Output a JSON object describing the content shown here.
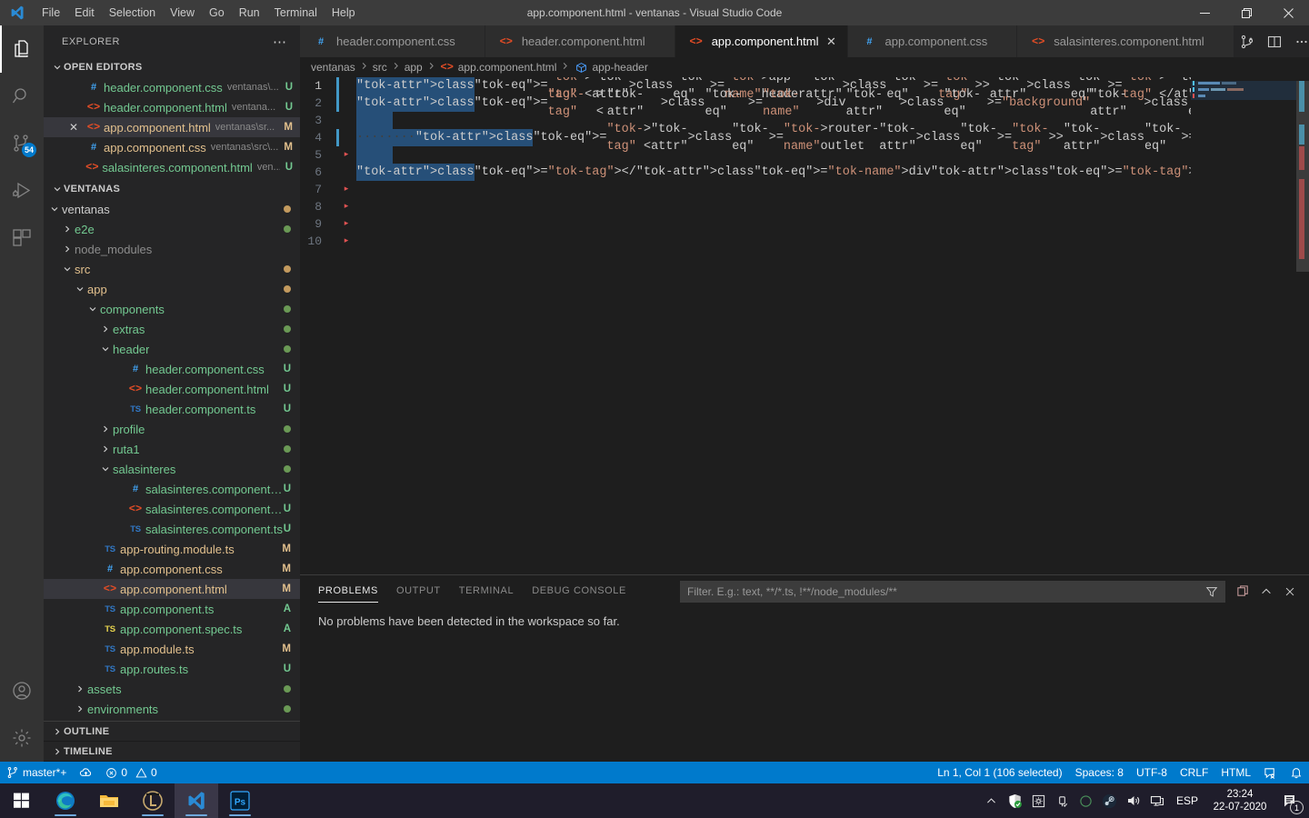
{
  "window": {
    "title": "app.component.html - ventanas - Visual Studio Code",
    "menus": [
      "File",
      "Edit",
      "Selection",
      "View",
      "Go",
      "Run",
      "Terminal",
      "Help"
    ],
    "controls": {
      "minimize": "─",
      "restore": "❐",
      "close": "✕"
    }
  },
  "activitybar": {
    "items": [
      {
        "name": "explorer",
        "icon": "files-icon",
        "badge": ""
      },
      {
        "name": "search",
        "icon": "search-icon",
        "badge": ""
      },
      {
        "name": "source-control",
        "icon": "source-control-icon",
        "badge": "54"
      },
      {
        "name": "run-and-debug",
        "icon": "debug-icon",
        "badge": ""
      },
      {
        "name": "extensions",
        "icon": "extensions-icon",
        "badge": ""
      }
    ],
    "bottom": [
      {
        "name": "accounts",
        "icon": "account-icon"
      },
      {
        "name": "manage",
        "icon": "gear-icon"
      }
    ]
  },
  "sidebar": {
    "title": "EXPLORER",
    "more_actions": "⋯",
    "open_editors": {
      "header": "OPEN EDITORS",
      "items": [
        {
          "name": "header.component.css",
          "path": "ventanas\\...",
          "status": "U",
          "icon": "css",
          "selected": false,
          "dirty": false
        },
        {
          "name": "header.component.html",
          "path": "ventana...",
          "status": "U",
          "icon": "html",
          "selected": false,
          "dirty": false
        },
        {
          "name": "app.component.html",
          "path": "ventanas\\sr...",
          "status": "M",
          "icon": "html",
          "selected": true,
          "dirty": false
        },
        {
          "name": "app.component.css",
          "path": "ventanas\\src\\...",
          "status": "M",
          "icon": "css",
          "selected": false,
          "dirty": false
        },
        {
          "name": "salasinteres.component.html",
          "path": "ven...",
          "status": "U",
          "icon": "html",
          "selected": false,
          "dirty": false
        }
      ]
    },
    "workspace": {
      "header": "VENTANAS",
      "rows": [
        {
          "label": "ventanas",
          "depth": 1,
          "type": "folder",
          "expanded": true,
          "dot": "#c39a5e"
        },
        {
          "label": "e2e",
          "depth": 2,
          "type": "folder",
          "expanded": false,
          "dot": "#6a9955",
          "color": "#73c991"
        },
        {
          "label": "node_modules",
          "depth": 2,
          "type": "folder",
          "expanded": false,
          "color": "#8c8c8c"
        },
        {
          "label": "src",
          "depth": 2,
          "type": "folder",
          "expanded": true,
          "dot": "#c39a5e",
          "color": "#e2c08d"
        },
        {
          "label": "app",
          "depth": 3,
          "type": "folder",
          "expanded": true,
          "dot": "#c39a5e",
          "color": "#e2c08d"
        },
        {
          "label": "components",
          "depth": 4,
          "type": "folder",
          "expanded": true,
          "dot": "#6a9955",
          "color": "#73c991"
        },
        {
          "label": "extras",
          "depth": 5,
          "type": "folder",
          "expanded": false,
          "dot": "#6a9955",
          "color": "#73c991"
        },
        {
          "label": "header",
          "depth": 5,
          "type": "folder",
          "expanded": true,
          "dot": "#6a9955",
          "color": "#73c991"
        },
        {
          "label": "header.component.css",
          "depth": 6,
          "type": "file",
          "icon": "css",
          "status": "U",
          "color": "#73c991"
        },
        {
          "label": "header.component.html",
          "depth": 6,
          "type": "file",
          "icon": "html",
          "status": "U",
          "color": "#73c991"
        },
        {
          "label": "header.component.ts",
          "depth": 6,
          "type": "file",
          "icon": "ts",
          "status": "U",
          "color": "#73c991"
        },
        {
          "label": "profile",
          "depth": 5,
          "type": "folder",
          "expanded": false,
          "dot": "#6a9955",
          "color": "#73c991"
        },
        {
          "label": "ruta1",
          "depth": 5,
          "type": "folder",
          "expanded": false,
          "dot": "#6a9955",
          "color": "#73c991"
        },
        {
          "label": "salasinteres",
          "depth": 5,
          "type": "folder",
          "expanded": true,
          "dot": "#6a9955",
          "color": "#73c991"
        },
        {
          "label": "salasinteres.component.css",
          "depth": 6,
          "type": "file",
          "icon": "css",
          "status": "U",
          "color": "#73c991"
        },
        {
          "label": "salasinteres.component.html",
          "depth": 6,
          "type": "file",
          "icon": "html",
          "status": "U",
          "color": "#73c991"
        },
        {
          "label": "salasinteres.component.ts",
          "depth": 6,
          "type": "file",
          "icon": "ts",
          "status": "U",
          "color": "#73c991"
        },
        {
          "label": "app-routing.module.ts",
          "depth": 4,
          "type": "file",
          "icon": "ts",
          "status": "M",
          "color": "#e2c08d"
        },
        {
          "label": "app.component.css",
          "depth": 4,
          "type": "file",
          "icon": "css",
          "status": "M",
          "color": "#e2c08d"
        },
        {
          "label": "app.component.html",
          "depth": 4,
          "type": "file",
          "icon": "html",
          "status": "M",
          "color": "#e2c08d",
          "selected": true
        },
        {
          "label": "app.component.ts",
          "depth": 4,
          "type": "file",
          "icon": "ts",
          "status": "A",
          "color": "#73c991"
        },
        {
          "label": "app.component.spec.ts",
          "depth": 4,
          "type": "file",
          "icon": "ts-y",
          "status": "A",
          "color": "#73c991"
        },
        {
          "label": "app.module.ts",
          "depth": 4,
          "type": "file",
          "icon": "ts",
          "status": "M",
          "color": "#e2c08d"
        },
        {
          "label": "app.routes.ts",
          "depth": 4,
          "type": "file",
          "icon": "ts",
          "status": "U",
          "color": "#73c991"
        },
        {
          "label": "assets",
          "depth": 3,
          "type": "folder",
          "expanded": false,
          "dot": "#6a9955",
          "color": "#73c991"
        },
        {
          "label": "environments",
          "depth": 3,
          "type": "folder",
          "expanded": false,
          "dot": "#6a9955",
          "color": "#73c991"
        }
      ]
    },
    "footer_sections": [
      "OUTLINE",
      "TIMELINE"
    ]
  },
  "editor": {
    "tabs": [
      {
        "label": "header.component.css",
        "icon": "css",
        "active": false,
        "closable": false
      },
      {
        "label": "header.component.html",
        "icon": "html",
        "active": false,
        "closable": false
      },
      {
        "label": "app.component.html",
        "icon": "html",
        "active": true,
        "closable": true
      },
      {
        "label": "app.component.css",
        "icon": "css",
        "active": false,
        "closable": false
      },
      {
        "label": "salasinteres.component.html",
        "icon": "html",
        "active": false,
        "closable": false
      }
    ],
    "tab_actions": [
      "split-editor-vertical-icon",
      "split-editor-icon",
      "more-actions-icon"
    ],
    "breadcrumb": [
      "ventanas",
      "src",
      "app",
      "app.component.html",
      "app-header"
    ],
    "line_numbers": [
      1,
      2,
      3,
      4,
      5,
      6,
      7,
      8,
      9,
      10
    ],
    "code_lines": [
      {
        "n": 1,
        "text": "<app-header></app-header>",
        "selected": true,
        "git": true,
        "fold": false
      },
      {
        "n": 2,
        "text": "<div class=\"background\">",
        "selected": true,
        "git": true,
        "fold": false
      },
      {
        "n": 3,
        "text": "",
        "selected": true,
        "git": false,
        "fold": false
      },
      {
        "n": 4,
        "text": "        <router-outlet></router-outlet>",
        "selected": true,
        "git": true,
        "fold": false
      },
      {
        "n": 5,
        "text": "",
        "selected": true,
        "git": false,
        "fold": true
      },
      {
        "n": 6,
        "text": "</div>",
        "selected": true,
        "git": false,
        "fold": false
      },
      {
        "n": 7,
        "text": "",
        "selected": false,
        "git": false,
        "fold": true
      },
      {
        "n": 8,
        "text": "",
        "selected": false,
        "git": false,
        "fold": true
      },
      {
        "n": 9,
        "text": "",
        "selected": false,
        "git": false,
        "fold": true
      },
      {
        "n": 10,
        "text": "",
        "selected": false,
        "git": false,
        "fold": true
      }
    ]
  },
  "panel": {
    "tabs": [
      "PROBLEMS",
      "OUTPUT",
      "TERMINAL",
      "DEBUG CONSOLE"
    ],
    "active_tab": "PROBLEMS",
    "filter_placeholder": "Filter. E.g.: text, **/*.ts, !**/node_modules/**",
    "filter_value": "",
    "actions": [
      "filter-icon",
      "clear-icon",
      "maximize-panel-icon",
      "close-panel-icon"
    ],
    "message": "No problems have been detected in the workspace so far."
  },
  "statusbar": {
    "branch": "master*+",
    "sync_icon": "sync-cloud-icon",
    "errors": "0",
    "warnings": "0",
    "position": "Ln 1, Col 1 (106 selected)",
    "indentation": "Spaces: 8",
    "encoding": "UTF-8",
    "eol": "CRLF",
    "language": "HTML",
    "feedback_icon": "feedback-icon",
    "bell_icon": "bell-icon"
  },
  "taskbar": {
    "start": "windows-start-icon",
    "apps": [
      {
        "name": "microsoft-edge",
        "icon": "edge-icon",
        "running": true,
        "active": false
      },
      {
        "name": "file-explorer",
        "icon": "folder-icon",
        "running": false,
        "active": false
      },
      {
        "name": "league-client",
        "icon": "league-icon",
        "running": true,
        "active": false
      },
      {
        "name": "visual-studio-code",
        "icon": "vscode-icon",
        "running": true,
        "active": true
      },
      {
        "name": "photoshop",
        "icon": "photoshop-icon",
        "running": true,
        "active": false
      }
    ],
    "tray": {
      "chevron": "show-hidden-icons-icon",
      "icons": [
        "windows-defender-icon",
        "settings-gear-icon",
        "usb-safely-remove-icon",
        "circle-icon",
        "steam-icon",
        "volume-icon",
        "network-icon"
      ],
      "language": "ESP",
      "time": "23:24",
      "date": "22-07-2020",
      "notifications": "1"
    }
  },
  "colors": {
    "accent": "#007acc",
    "titlebar": "#3c3c3c",
    "activitybar": "#333333",
    "sidebar": "#252526",
    "editor": "#1e1e1e",
    "selection": "#264f78",
    "modified": "#e2c08d",
    "untracked": "#73c991",
    "added": "#73c991"
  }
}
